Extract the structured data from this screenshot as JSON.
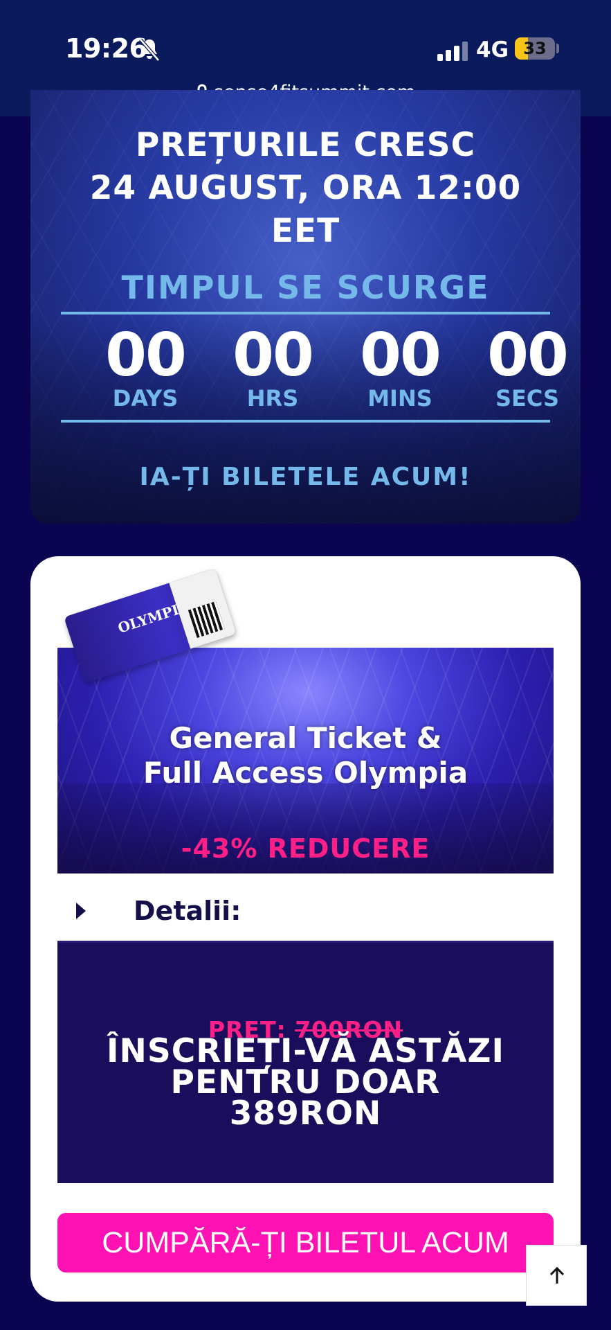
{
  "status_bar": {
    "time": "19:26",
    "network": "4G",
    "battery": "33",
    "battery_color": "#f5c518"
  },
  "browser": {
    "url": "sense4fitsummit.com"
  },
  "hero": {
    "price_lines": [
      "PREȚURILE CRESC",
      "24 AUGUST, ORA 12:00",
      "EET"
    ],
    "countdown_title": "TIMPUL SE SCURGE",
    "countdown": [
      {
        "value": "00",
        "label": "DAYS"
      },
      {
        "value": "00",
        "label": "HRS"
      },
      {
        "value": "00",
        "label": "MINS"
      },
      {
        "value": "00",
        "label": "SECS"
      }
    ],
    "cta_text": "IA-ȚI BILETELE ACUM!",
    "accent": "#74b9ea"
  },
  "card": {
    "banner_title_line1": "General Ticket &",
    "banner_title_line2": "Full Access Olympia",
    "banner_discount": "-43% REDUCERE",
    "ticket_logo": "OLYMPIA",
    "details_label": "Detalii:",
    "old_price_label": "PREȚ:",
    "old_price_value": "700RON",
    "price_line1": "ÎNSCRIEȚI-VĂ ASTĂZI",
    "price_line2": "PENTRU DOAR",
    "price_line3": "389RON",
    "buy_button": "CUMPĂRĂ-ȚI BILETUL ACUM",
    "accent_pink": "#ff12b4"
  }
}
